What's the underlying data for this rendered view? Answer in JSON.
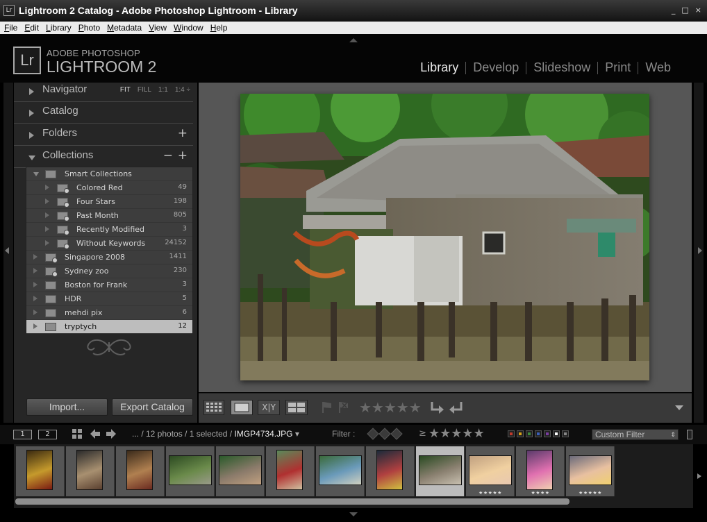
{
  "window": {
    "title": "Lightroom 2 Catalog - Adobe Photoshop Lightroom - Library",
    "app_icon_text": "Lr",
    "controls": [
      "_",
      "□",
      "×"
    ]
  },
  "menu": [
    "File",
    "Edit",
    "Library",
    "Photo",
    "Metadata",
    "View",
    "Window",
    "Help"
  ],
  "identity": {
    "logo": "Lr",
    "line1": "ADOBE PHOTOSHOP",
    "line2": "LIGHTROOM 2"
  },
  "modules": [
    {
      "label": "Library",
      "active": true
    },
    {
      "label": "Develop",
      "active": false
    },
    {
      "label": "Slideshow",
      "active": false
    },
    {
      "label": "Print",
      "active": false
    },
    {
      "label": "Web",
      "active": false
    }
  ],
  "left_panel": {
    "navigator": {
      "label": "Navigator",
      "options": [
        "FIT",
        "FILL",
        "1:1",
        "1:4 ÷"
      ]
    },
    "catalog": {
      "label": "Catalog"
    },
    "folders": {
      "label": "Folders",
      "add": "+"
    },
    "collections": {
      "label": "Collections",
      "remove": "−",
      "add": "+"
    },
    "collection_rows": [
      {
        "name": "Smart Collections",
        "count": "",
        "indent": 0,
        "expanded": true,
        "smart": false,
        "selected": false
      },
      {
        "name": "Colored Red",
        "count": "49",
        "indent": 1,
        "expanded": false,
        "smart": true,
        "selected": false
      },
      {
        "name": "Four Stars",
        "count": "198",
        "indent": 1,
        "expanded": false,
        "smart": true,
        "selected": false
      },
      {
        "name": "Past Month",
        "count": "805",
        "indent": 1,
        "expanded": false,
        "smart": true,
        "selected": false
      },
      {
        "name": "Recently Modified",
        "count": "3",
        "indent": 1,
        "expanded": false,
        "smart": true,
        "selected": false
      },
      {
        "name": "Without Keywords",
        "count": "24152",
        "indent": 1,
        "expanded": false,
        "smart": true,
        "selected": false
      },
      {
        "name": "Singapore 2008",
        "count": "1411",
        "indent": 0,
        "expanded": false,
        "smart": true,
        "selected": false
      },
      {
        "name": "Sydney zoo",
        "count": "230",
        "indent": 0,
        "expanded": false,
        "smart": true,
        "selected": false
      },
      {
        "name": "Boston for Frank",
        "count": "3",
        "indent": 0,
        "expanded": false,
        "smart": false,
        "selected": false
      },
      {
        "name": "HDR",
        "count": "5",
        "indent": 0,
        "expanded": false,
        "smart": false,
        "selected": false
      },
      {
        "name": "mehdi pix",
        "count": "6",
        "indent": 0,
        "expanded": false,
        "smart": false,
        "selected": false
      },
      {
        "name": "tryptych",
        "count": "12",
        "indent": 0,
        "expanded": false,
        "smart": false,
        "selected": true
      }
    ],
    "import_label": "Import...",
    "export_label": "Export Catalog"
  },
  "toolbar": {
    "icons": [
      "grid-view-icon",
      "loupe-view-icon",
      "compare-view-icon",
      "survey-view-icon",
      "flag-pick-icon",
      "flag-reject-icon",
      "rotate-left-icon",
      "rotate-right-icon"
    ],
    "compare_label": "X|Y",
    "stars": "★★★★★",
    "rating": 0
  },
  "filmstrip_header": {
    "monitor1": "1",
    "monitor2": "2",
    "path_prefix": "... / 12 photos / 1 selected / ",
    "filename": "IMGP4734.JPG",
    "filename_caret": "▾",
    "filter_label": "Filter :",
    "rating_op": "≥",
    "filter_stars": "★★★★★",
    "color_labels": [
      "#c0392b",
      "#d4a017",
      "#3c8c3c",
      "#3a5fb8",
      "#7a3ca0",
      "#ffffff",
      "#888888"
    ],
    "custom_filter": "Custom Filter"
  },
  "filmstrip": [
    {
      "name": "thumb-statue-gold",
      "stars": "",
      "selected": false,
      "colors": [
        "#3a2a10",
        "#c59a2c",
        "#7a1a12"
      ]
    },
    {
      "name": "thumb-statue-ganesh",
      "stars": "",
      "selected": false,
      "colors": [
        "#2a2a2a",
        "#a89070",
        "#5a4030"
      ]
    },
    {
      "name": "thumb-temple-figures",
      "stars": "",
      "selected": false,
      "colors": [
        "#3a2a1a",
        "#b08050",
        "#6a2a20"
      ]
    },
    {
      "name": "thumb-shed-greens",
      "stars": "",
      "selected": false,
      "colors": [
        "#2c4a22",
        "#6a8a4a",
        "#9a9a8a"
      ]
    },
    {
      "name": "thumb-stilt-house",
      "stars": "",
      "selected": false,
      "colors": [
        "#2a5a2a",
        "#8a7a6a",
        "#c0a080"
      ]
    },
    {
      "name": "thumb-red-roof-house",
      "stars": "",
      "selected": false,
      "colors": [
        "#5a8a5a",
        "#b03030",
        "#d0c0a0"
      ]
    },
    {
      "name": "thumb-blue-house",
      "stars": "",
      "selected": false,
      "colors": [
        "#3a6a3a",
        "#6a9aba",
        "#d0d0c0"
      ]
    },
    {
      "name": "thumb-fishing-boats",
      "stars": "",
      "selected": false,
      "colors": [
        "#1a2a3a",
        "#b04040",
        "#d0c040"
      ]
    },
    {
      "name": "thumb-wooden-hut",
      "stars": "",
      "selected": true,
      "colors": [
        "#2a4a22",
        "#8a8070",
        "#c8c0b0"
      ]
    },
    {
      "name": "thumb-girl-blonde",
      "stars": "★★★★★",
      "selected": false,
      "colors": [
        "#c0a080",
        "#f0d0a0",
        "#e8c8b0"
      ]
    },
    {
      "name": "thumb-girl-pink",
      "stars": "★★★★",
      "selected": false,
      "colors": [
        "#5a3a6a",
        "#e070b0",
        "#f0d0b0"
      ]
    },
    {
      "name": "thumb-girl-toy",
      "stars": "★★★★★",
      "selected": false,
      "colors": [
        "#6a6a7a",
        "#e8c0a0",
        "#f0d070"
      ]
    }
  ]
}
